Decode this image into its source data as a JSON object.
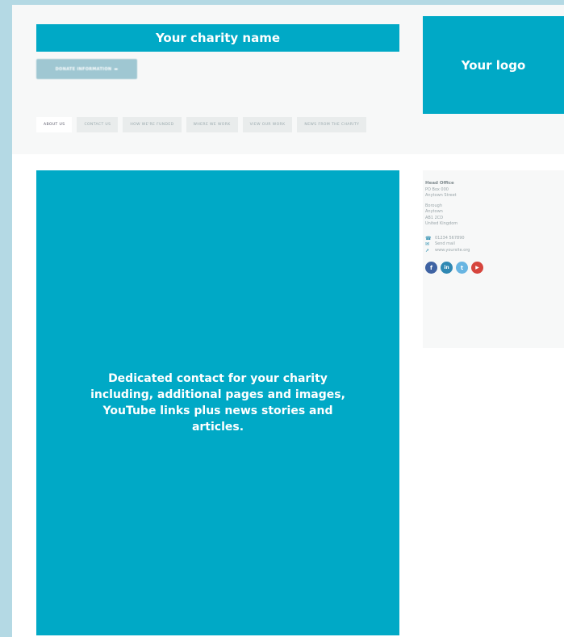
{
  "header": {
    "charity_name": "Your charity name",
    "donate_button": "DONATE INFORMATION",
    "logo_placeholder": "Your logo"
  },
  "nav": {
    "tabs": [
      {
        "label": "ABOUT US"
      },
      {
        "label": "CONTACT US"
      },
      {
        "label": "HOW WE'RE FUNDED"
      },
      {
        "label": "WHERE WE WORK"
      },
      {
        "label": "VIEW OUR WORK"
      },
      {
        "label": "NEWS FROM THE CHARITY"
      }
    ]
  },
  "main": {
    "description": "Dedicated contact for your charity including, additional pages and images, YouTube links plus news stories and articles."
  },
  "contact": {
    "title": "Head Office",
    "address": [
      "PO Box 000",
      "Anytown Street",
      "Borough",
      "Anytown",
      "AB1 2CD",
      "United Kingdom"
    ],
    "phone": "01234 567890",
    "email": "Send mail",
    "website": "www.yoursite.org"
  },
  "social": [
    {
      "name": "facebook",
      "glyph": "f",
      "color": "#3f63a3"
    },
    {
      "name": "linkedin",
      "glyph": "in",
      "color": "#2f88b3"
    },
    {
      "name": "twitter",
      "glyph": "t",
      "color": "#68b5e2"
    },
    {
      "name": "youtube",
      "glyph": "▶",
      "color": "#d6453d"
    }
  ]
}
